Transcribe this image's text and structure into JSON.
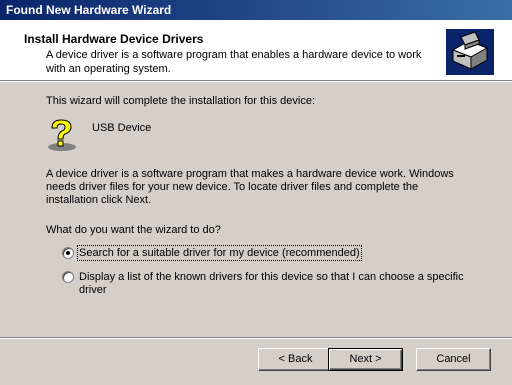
{
  "window": {
    "title": "Found New Hardware Wizard"
  },
  "header": {
    "title": "Install Hardware Device Drivers",
    "subtitle": "A device driver is a software program that enables a hardware device to work with an operating system.",
    "icon": "hardware-wizard-icon"
  },
  "body": {
    "intro": "This wizard will complete the installation for this device:",
    "device_icon": "question-mark-icon",
    "device_name": "USB Device",
    "description": "A device driver is a software program that makes a hardware device work. Windows needs driver files for your new device. To locate driver files and complete the installation click Next.",
    "question": "What do you want the wizard to do?",
    "options": [
      {
        "label": "Search for a suitable driver for my device (recommended)",
        "selected": true,
        "mnemonic": "S"
      },
      {
        "label": "Display a list of the known drivers for this device so that I can choose a specific driver",
        "selected": false,
        "mnemonic": "D"
      }
    ]
  },
  "buttons": {
    "back": {
      "label": "< Back",
      "mnemonic": "B"
    },
    "next": {
      "label": "Next >",
      "mnemonic": "N"
    },
    "cancel": {
      "label": "Cancel"
    }
  },
  "colors": {
    "titlebar_start": "#0a246a",
    "titlebar_end": "#3a6ea5",
    "face": "#d4d0c8"
  }
}
